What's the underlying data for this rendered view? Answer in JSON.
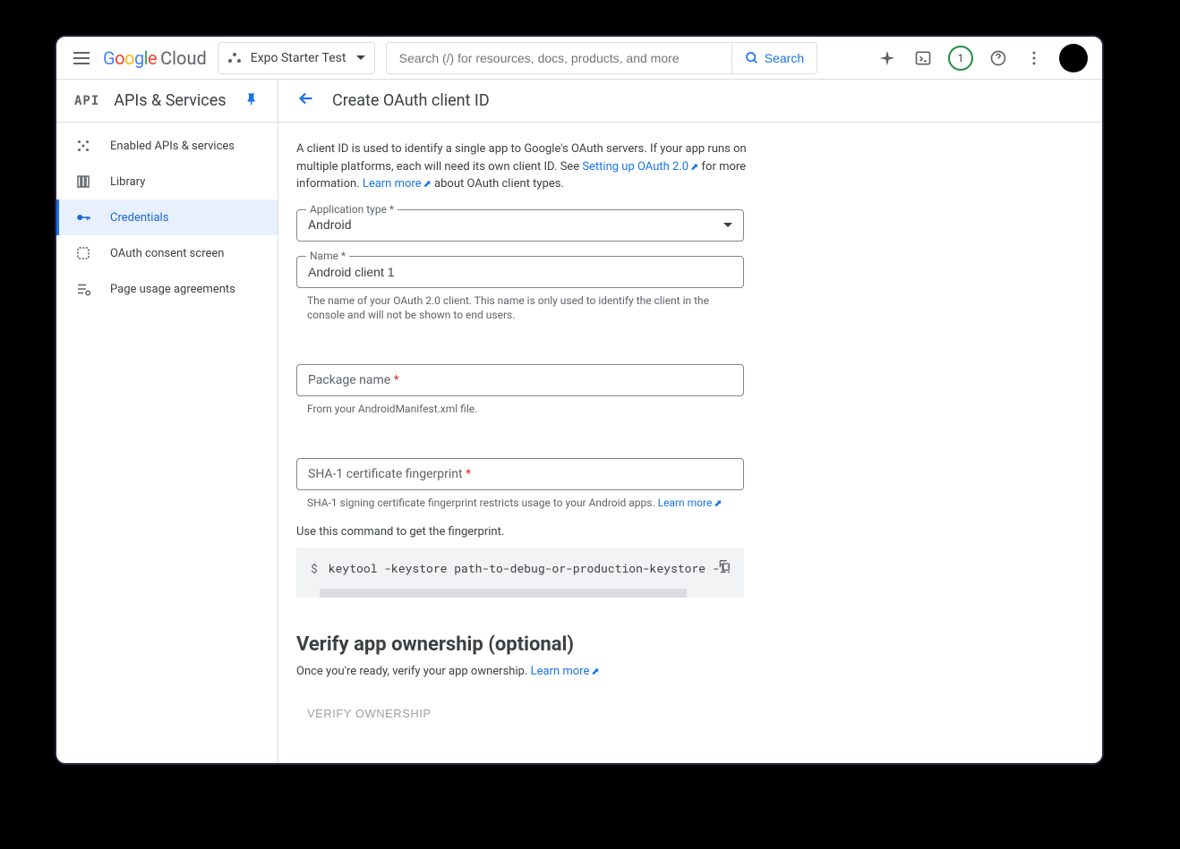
{
  "topbar": {
    "project_name": "Expo Starter Test",
    "search_placeholder": "Search (/) for resources, docs, products, and more",
    "search_button": "Search",
    "badge_count": "1"
  },
  "sidebar": {
    "section_logo": "API",
    "section_title": "APIs & Services",
    "items": [
      {
        "label": "Enabled APIs & services",
        "active": false
      },
      {
        "label": "Library",
        "active": false
      },
      {
        "label": "Credentials",
        "active": true
      },
      {
        "label": "OAuth consent screen",
        "active": false
      },
      {
        "label": "Page usage agreements",
        "active": false
      }
    ]
  },
  "page": {
    "title": "Create OAuth client ID",
    "intro_text_1": "A client ID is used to identify a single app to Google's OAuth servers. If your app runs on multiple platforms, each will need its own client ID. See ",
    "intro_link_1": "Setting up OAuth 2.0",
    "intro_text_2": " for more information. ",
    "intro_link_2": "Learn more",
    "intro_text_3": " about OAuth client types.",
    "app_type_label": "Application type *",
    "app_type_value": "Android",
    "name_label": "Name *",
    "name_value": "Android client 1",
    "name_helper": "The name of your OAuth 2.0 client. This name is only used to identify the client in the console and will not be shown to end users.",
    "package_label": "Package name",
    "package_helper": "From your AndroidManifest.xml file.",
    "sha1_label": "SHA-1 certificate fingerprint",
    "sha1_helper_text": "SHA-1 signing certificate fingerprint restricts usage to your Android apps. ",
    "sha1_helper_link": "Learn more",
    "fingerprint_instruction": "Use this command to get the fingerprint.",
    "code_prompt": "$",
    "code_command": "keytool -keystore path-to-debug-or-production-keystore -list",
    "verify_title": "Verify app ownership (optional)",
    "verify_desc_text": "Once you're ready, verify your app ownership. ",
    "verify_desc_link": "Learn more",
    "verify_button": "VERIFY OWNERSHIP"
  }
}
